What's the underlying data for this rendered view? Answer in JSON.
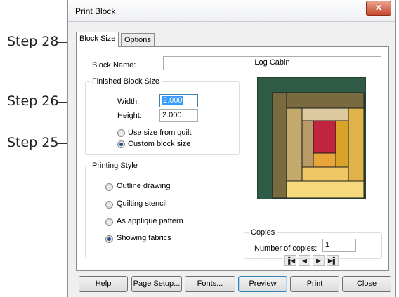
{
  "callouts": [
    "Step 28",
    "Step 26",
    "Step 25"
  ],
  "window": {
    "title": "Print Block",
    "close_glyph": "✕"
  },
  "tabs": [
    "Block Size",
    "Options"
  ],
  "block_name": {
    "label": "Block Name:",
    "value": "Log Cabin"
  },
  "finished_size": {
    "title": "Finished Block Size",
    "width_label": "Width:",
    "width_value": "2.000",
    "height_label": "Height:",
    "height_value": "2.000",
    "option_quilt": "Use size from quilt",
    "option_custom": "Custom block size",
    "selected": "Custom block size"
  },
  "printing_style": {
    "title": "Printing Style",
    "options": [
      "Outline drawing",
      "Quilting stencil",
      "As applique pattern",
      "Showing fabrics"
    ],
    "selected": "Showing fabrics"
  },
  "preview": {
    "nav_icons": [
      "first-page-icon",
      "prev-page-icon",
      "next-page-icon",
      "last-page-icon"
    ],
    "nav_glyphs": [
      "▐◀",
      "◀",
      "▶",
      "▶▌"
    ]
  },
  "copies": {
    "title": "Copies",
    "label": "Number of copies:",
    "value": "1"
  },
  "buttons": [
    "Help",
    "Page Setup...",
    "Fonts...",
    "Preview",
    "Print",
    "Close"
  ],
  "colors": {
    "dark_green": "#2f5a45",
    "olive": "#7a6a40",
    "khaki": "#c3a96b",
    "tan": "#b79a66",
    "light_tan": "#ddc9a0",
    "crimson": "#c0243f",
    "orange": "#e8a53a",
    "gold": "#d9a22a",
    "light_yellow": "#f5d97a",
    "accent_blue": "#3399ff"
  }
}
